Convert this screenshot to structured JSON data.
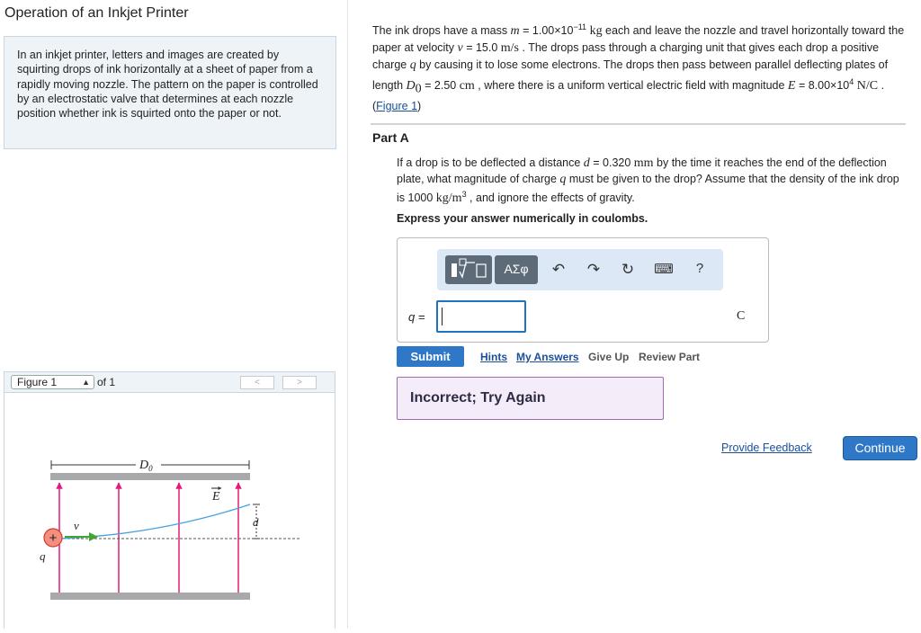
{
  "left": {
    "title": "Operation of an Inkjet Printer",
    "intro": "In an inkjet printer, letters and images are created by squirting drops of ink horizontally at a sheet of paper from a rapidly moving nozzle. The pattern on the paper is controlled by an electrostatic valve that determines at each nozzle position whether ink is squirted onto the paper or not.",
    "figure_select": "Figure 1",
    "figure_of": "of 1",
    "prev_icon": "<",
    "next_icon": ">",
    "figure": {
      "label_D0": "D",
      "label_D0_sub": "0",
      "label_E": "E",
      "label_v": "v",
      "label_d": "d",
      "label_q": "q",
      "charge_symbol": "+"
    }
  },
  "problem": {
    "t1": "The ink drops have a mass ",
    "m": "m",
    "t2": " = 1.00×10",
    "m_exp": "−11",
    "kg": " kg",
    "t3": " each and leave the nozzle and travel horizontally toward the paper at velocity ",
    "v": "v",
    "t4": " = 15.0 ",
    "ms": "m/s",
    "t5": " . The drops pass through a charging unit that gives each drop a positive charge ",
    "q": "q",
    "t6": " by causing it to lose some electrons. The drops then pass between parallel deflecting plates of length ",
    "D": "D",
    "D_sub": "0",
    "t7": " = 2.50 ",
    "cm": "cm",
    "t8": " , where there is a uniform vertical electric field with magnitude ",
    "E": "E",
    "t9": " = 8.00×10",
    "E_exp": "4",
    "NC": " N/C",
    "t10": " . (",
    "fig_link": "Figure 1",
    "t11": ")"
  },
  "part": {
    "label": "Part A",
    "q1": "If a drop is to be deflected a distance ",
    "d": "d",
    "q2": " = 0.320 ",
    "mm": "mm",
    "q3": " by the time it reaches the end of the deflection plate, what magnitude of charge ",
    "q": "q",
    "q4": " must be given to the drop? Assume that the density of the ink drop is 1000 ",
    "kgm": "kg/m",
    "kgm_exp": "3",
    "q5": " , and ignore the effects of gravity.",
    "express": "Express your answer numerically in coulombs."
  },
  "answer": {
    "templates_icon": "templates-icon",
    "greek_label": "ΑΣφ",
    "undo_icon": "↶",
    "redo_icon": "↷",
    "reset_icon": "↻",
    "keyboard_icon": "⌨",
    "help_label": "?",
    "var_label": "q =",
    "input_value": "",
    "unit": "C"
  },
  "actions": {
    "submit": "Submit",
    "hints": "Hints",
    "my_answers": "My Answers",
    "give_up": "Give Up",
    "review_part": "Review Part",
    "feedback": "Incorrect; Try Again",
    "provide_feedback": "Provide Feedback",
    "continue": "Continue"
  },
  "colors": {
    "accent": "#2e78c7",
    "plate": "#a7a9ab",
    "field_line": "#e6187d",
    "trajectory": "#4aa3df",
    "drop_fill": "#f48e7e",
    "drop_stroke": "#d23b2a",
    "velocity": "#3fa535"
  }
}
